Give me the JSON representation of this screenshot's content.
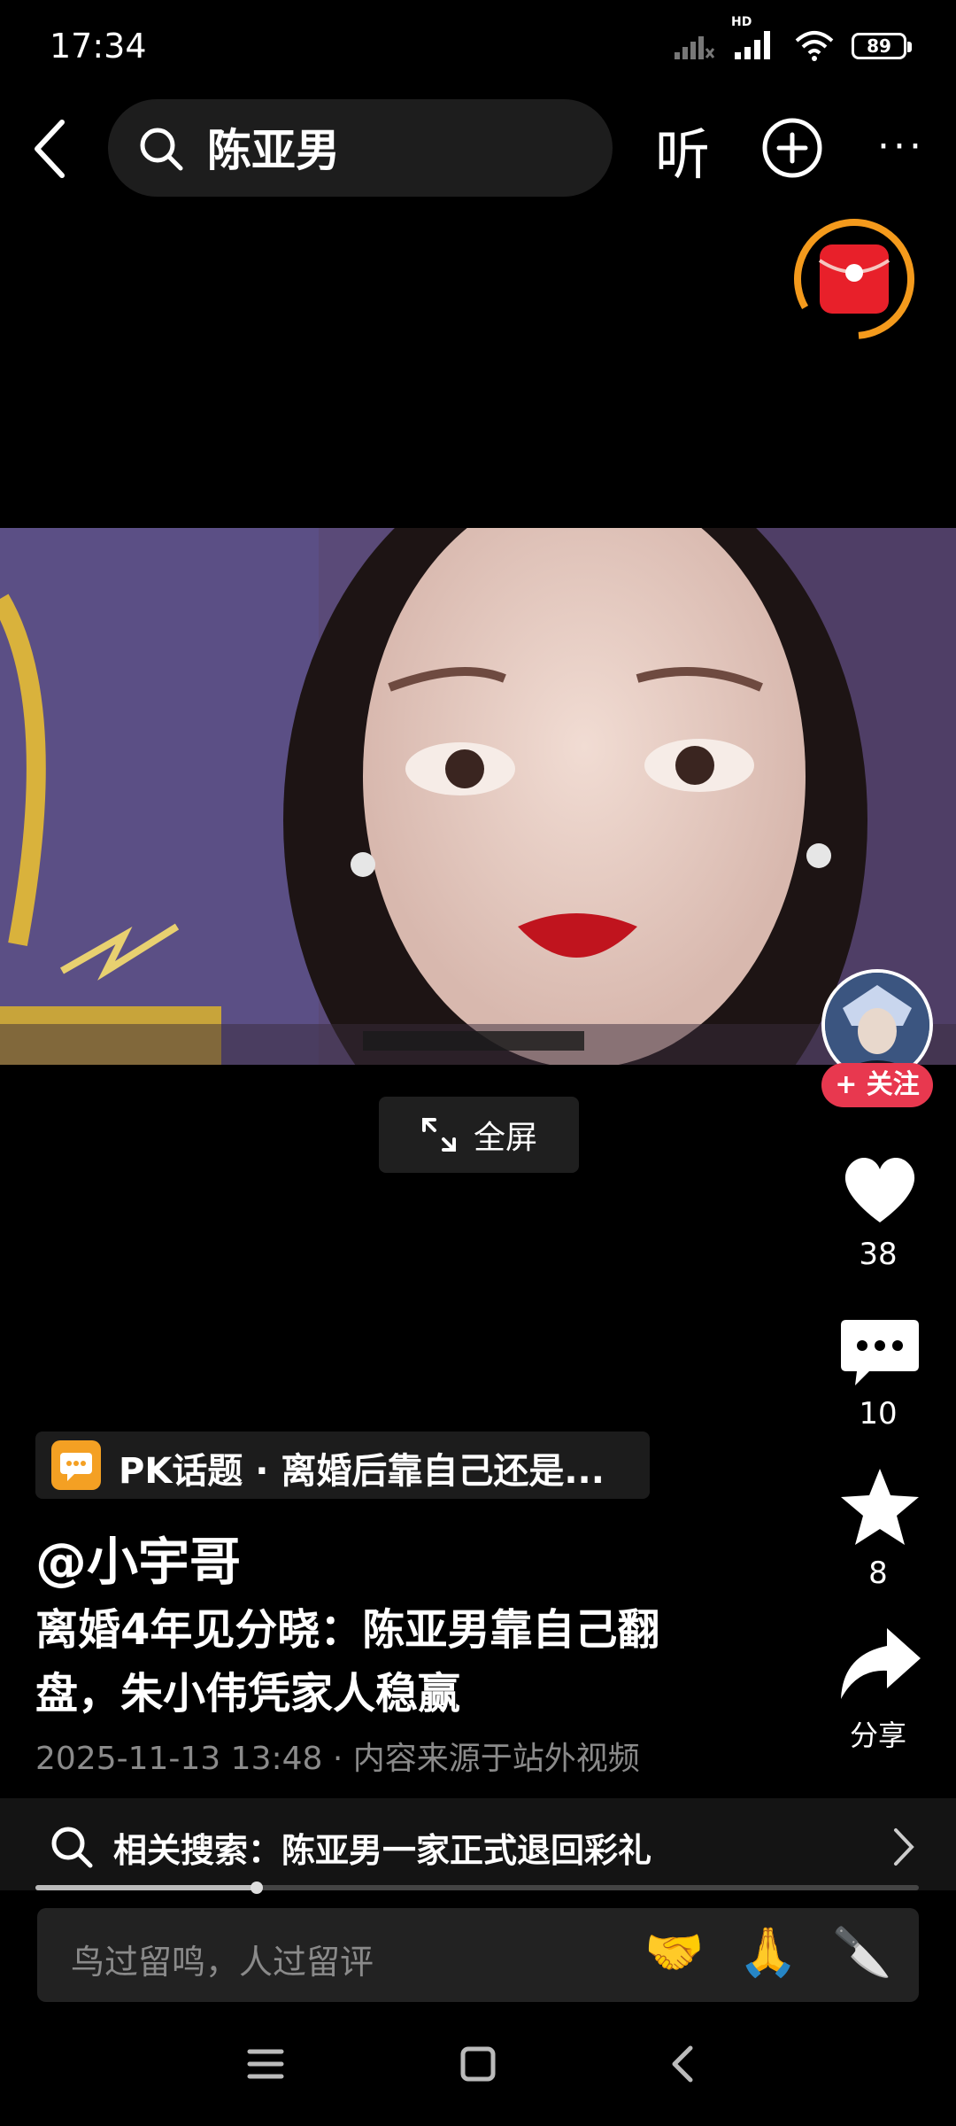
{
  "status_bar": {
    "time": "17:34",
    "network": "HD",
    "battery": "89"
  },
  "top_bar": {
    "search_query": "陈亚男",
    "listen_label": "听"
  },
  "video": {
    "fullscreen_label": "全屏",
    "follow_label": "+ 关注"
  },
  "actions": {
    "likes": "38",
    "comments": "10",
    "favorites": "8",
    "share_label": "分享"
  },
  "post": {
    "topic": "PK话题 · 离婚后靠自己还是...",
    "author": "@小宇哥",
    "description": "离婚4年见分晓：陈亚男靠自己翻盘，朱小伟凭家人稳赢",
    "meta": "2025-11-13 13:48 · 内容来源于站外视频",
    "progress": 0.25
  },
  "related": {
    "text": "相关搜索：陈亚男一家正式退回彩礼"
  },
  "comment_bar": {
    "placeholder": "鸟过留鸣，人过留评",
    "emojis": [
      "🤝",
      "🙏",
      "🔪"
    ]
  },
  "icons": [
    "back-icon",
    "search-icon",
    "add-icon",
    "more-icon",
    "red-packet-icon",
    "expand-icon",
    "heart-icon",
    "comment-icon",
    "star-icon",
    "share-icon",
    "chevron-right-icon",
    "menu-icon",
    "home-icon",
    "back-nav-icon"
  ]
}
